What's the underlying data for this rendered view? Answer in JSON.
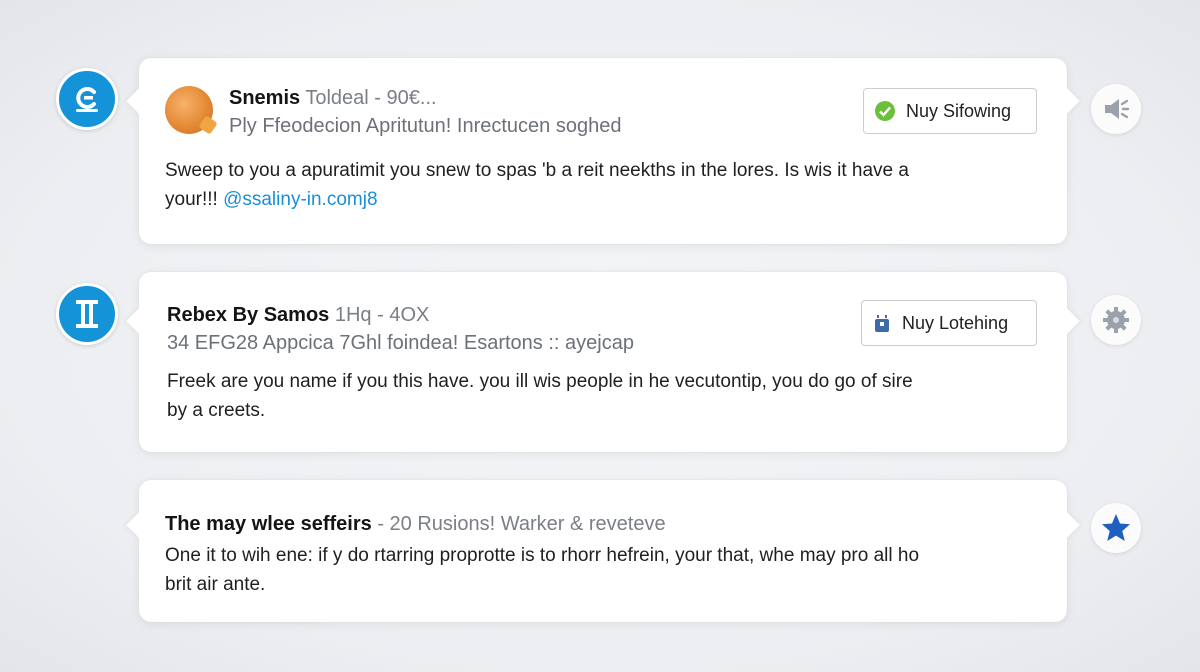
{
  "posts": [
    {
      "author": "Snemis",
      "meta": "Toldeal - 90€...",
      "subtitle": "Ply Ffeodecion Apritutun! Inrectucen soghed",
      "body": "Sweep to you  a apuratimit you snew to spas 'b a reit neekths in the lores. Is wis it have a",
      "body_line2_prefix": "your!!! ",
      "link": "@ssaliny-in.comj8",
      "follow_label": "Nuy Sifowing",
      "side_icon": "brand-c-icon",
      "right_icon": "speaker-icon"
    },
    {
      "author": "Rebex By Samos",
      "meta": "1Hq - 4OX",
      "subtitle": "34 EFG28 Appcica 7Ghl foindea! Esartons :: ayejcap",
      "body_line1": "Freek are you name if you this have. you ill wis people in he vecutontip, you do go of sire",
      "body_line2": "by a creets.",
      "follow_label": "Nuy Lotehing",
      "side_icon": "pillar-icon",
      "right_icon": "gear-icon"
    },
    {
      "author": "The may wlee seffeirs",
      "meta": "- 20 Rusions! Warker & reveteve",
      "body_line1": "One it to wih ene: if y do rtarring proprotte is to rhorr hefrein, your that, whe may pro all ho",
      "body_line2": "brit air ante.",
      "right_icon": "star-icon"
    }
  ],
  "colors": {
    "accent": "#1493d9",
    "link": "#1a8fd8",
    "star": "#1f5fbf",
    "check": "#6cbf3a"
  }
}
